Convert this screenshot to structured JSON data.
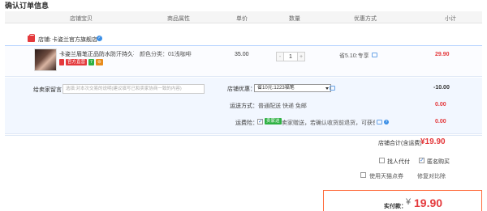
{
  "page_title": "确认订单信息",
  "columns": {
    "shop_item": "店铺宝贝",
    "attributes": "商品属性",
    "unit_price": "单价",
    "quantity": "数量",
    "discount": "优惠方式",
    "subtotal": "小计"
  },
  "shop": {
    "label": "店铺:",
    "name": "卡姿兰官方旗舰店"
  },
  "item": {
    "name": "卡姿兰眉笔正品防水防汗持久不...",
    "badges": [
      "官方直营",
      "7",
      "⊜"
    ],
    "attr": "颜色分类：01浅咖啡",
    "price": "35.00",
    "qty": "1",
    "qty_minus": "-",
    "qty_plus": "+",
    "discount": "省5.10:专享",
    "subtotal": "29.90"
  },
  "remark": {
    "label": "给卖家留言：",
    "placeholder": "选填:对本次交易的说明(建议填写已和卖家协商一致的内容)"
  },
  "shop_discount": {
    "label": "店铺优惠：",
    "selected": "省10元:1223福笔",
    "amount": "-10.00"
  },
  "shipping": {
    "label": "运送方式：",
    "value": "普通配送 快递 免邮",
    "amount": "0.00"
  },
  "insurance": {
    "label": "运费险：",
    "badge": "卖家送",
    "text": "卖家赠送，若确认收货前退货，可获保...",
    "amount": "0.00"
  },
  "shop_total": {
    "label": "店铺合计(含运费)",
    "value": "¥19.90"
  },
  "options": {
    "proxy_pay": "找人代付",
    "anonymous": "匿名购买",
    "tmall_coupon": "使用天猫点券",
    "coupon_value": "修复对比除"
  },
  "pay": {
    "label": "实付款：",
    "currency": "¥",
    "amount": "19.90"
  },
  "colors": {
    "accent_red": "#e4393c",
    "link_blue": "#3a8ee6",
    "pay_border": "#ff6a3a"
  }
}
